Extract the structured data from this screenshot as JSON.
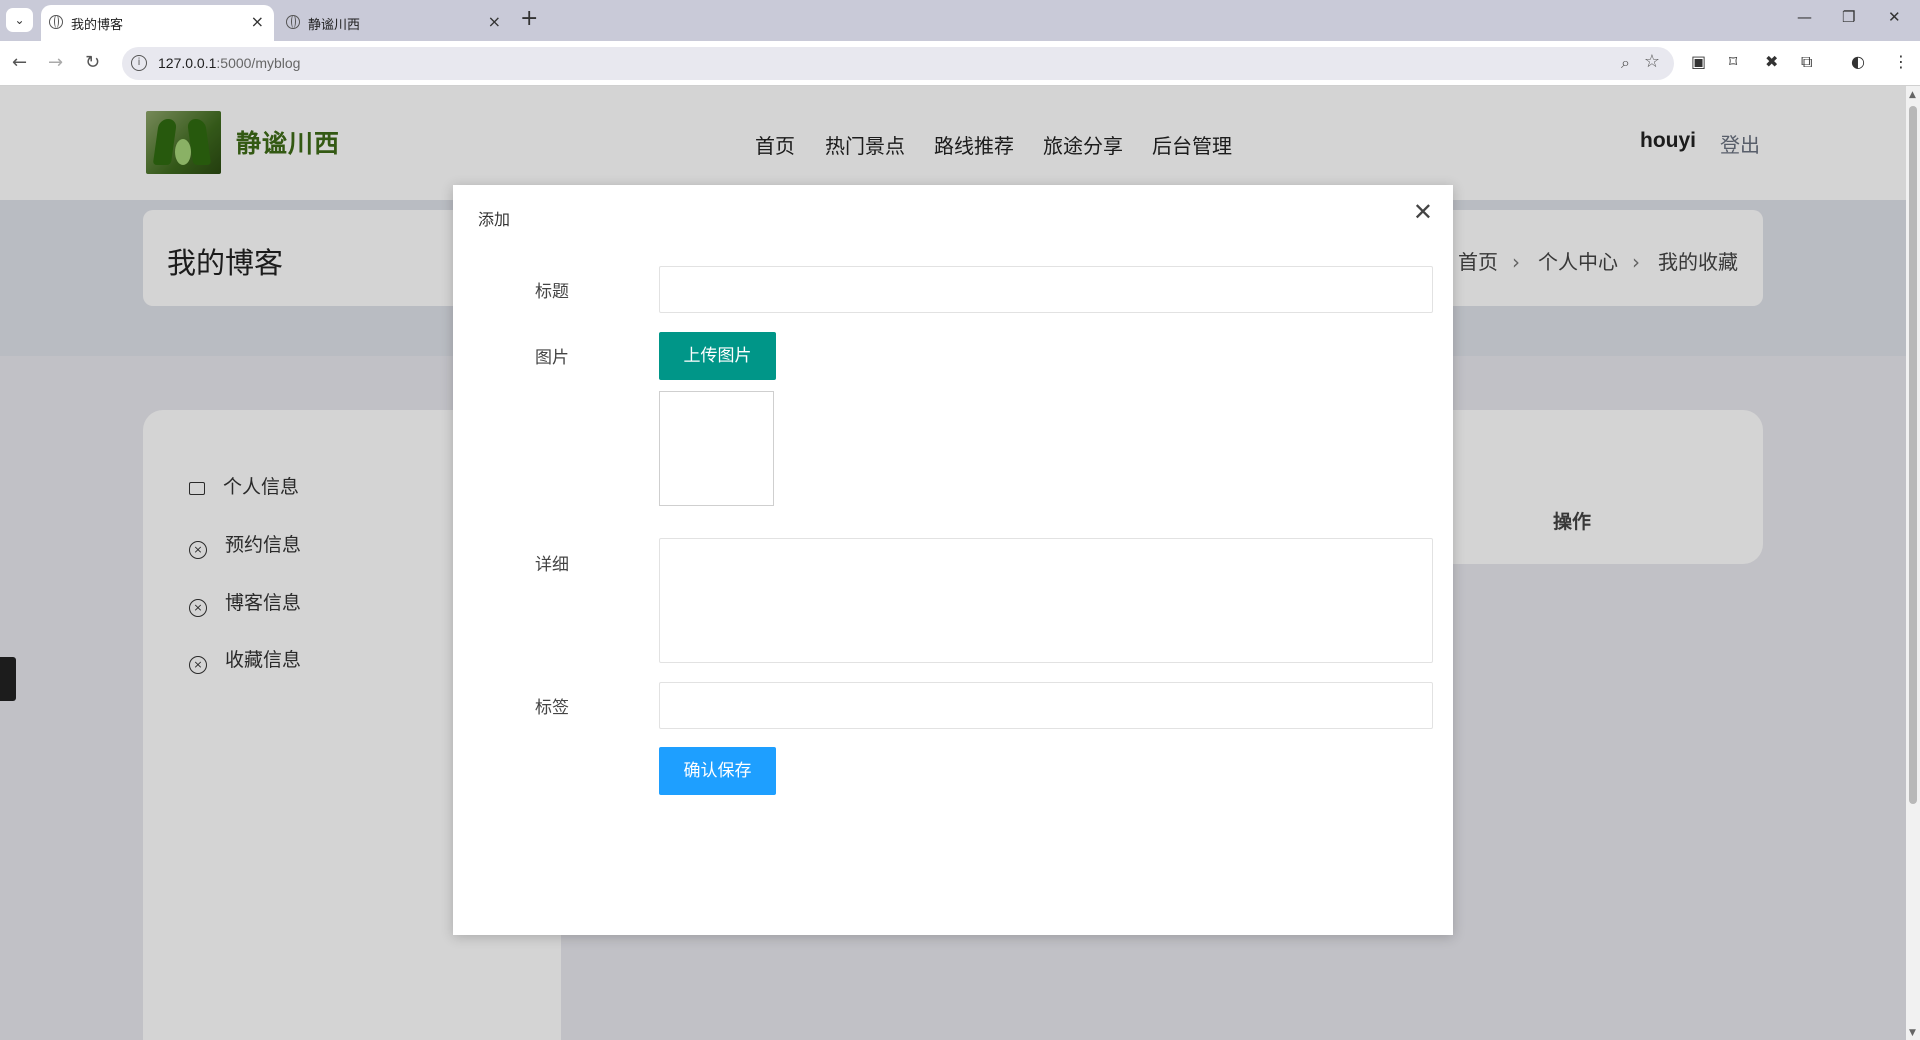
{
  "browser": {
    "tabs": [
      {
        "title": "我的博客",
        "active": true
      },
      {
        "title": "静谧川西",
        "active": false
      }
    ],
    "url_host": "127.0.0.1",
    "url_path": ":5000/myblog"
  },
  "header": {
    "logo_text": "静谧川西",
    "nav": [
      "首页",
      "热门景点",
      "路线推荐",
      "旅途分享",
      "后台管理"
    ],
    "username": "houyi",
    "logout": "登出"
  },
  "banner": {
    "title": "我的博客",
    "breadcrumbs": [
      "首页",
      "个人中心",
      "我的收藏"
    ]
  },
  "sidebar": {
    "items": [
      {
        "label": "个人信息",
        "icon": "id-card-icon"
      },
      {
        "label": "预约信息",
        "icon": "circle-x-icon"
      },
      {
        "label": "博客信息",
        "icon": "circle-x-icon"
      },
      {
        "label": "收藏信息",
        "icon": "circle-x-icon"
      }
    ]
  },
  "table": {
    "action_header": "操作"
  },
  "modal": {
    "title": "添加",
    "fields": {
      "title_label": "标题",
      "title_value": "",
      "image_label": "图片",
      "upload_label": "上传图片",
      "detail_label": "详细",
      "detail_value": "",
      "tags_label": "标签",
      "tags_value": ""
    },
    "save_label": "确认保存"
  },
  "colors": {
    "upload_button": "#009688",
    "save_button": "#1e9fff",
    "logo_green": "#3e6b17"
  }
}
